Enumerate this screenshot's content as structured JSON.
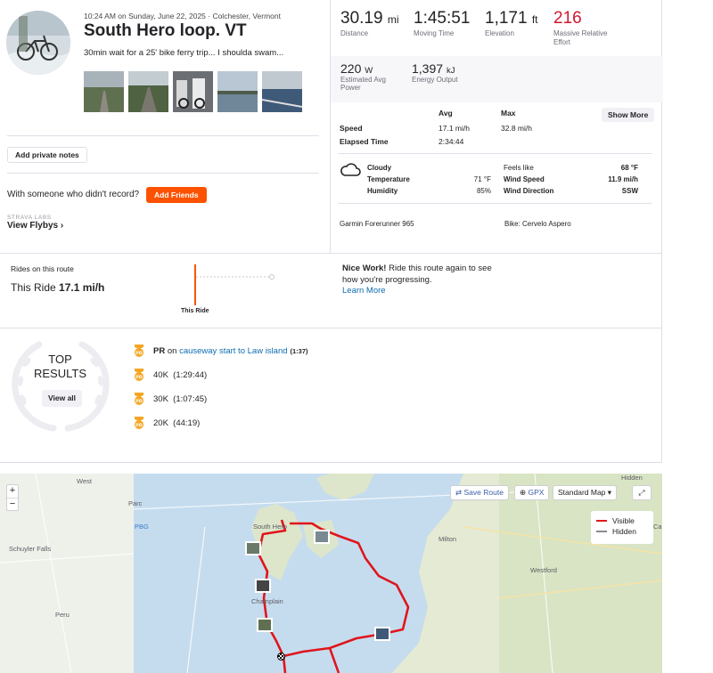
{
  "activity": {
    "datetime_location": "10:24 AM on Sunday, June 22, 2025 · Colchester, Vermont",
    "title": "South Hero loop. VT",
    "description": "30min wait for a 25' bike ferry trip... I shoulda swam..."
  },
  "actions": {
    "private_notes": "Add private notes",
    "with_someone": "With someone who didn't record?",
    "add_friends": "Add Friends",
    "labs": "STRAVA LABS",
    "view_flybys": "View Flybys ›"
  },
  "stats": {
    "distance_value": "30.19",
    "distance_unit": "mi",
    "distance_label": "Distance",
    "moving_time_value": "1:45:51",
    "moving_time_label": "Moving Time",
    "elevation_value": "1,171",
    "elevation_unit": "ft",
    "elevation_label": "Elevation",
    "effort_value": "216",
    "effort_label_1": "Massive Relative",
    "effort_label_2": "Effort",
    "power_value": "220",
    "power_unit": "W",
    "power_label_1": "Estimated Avg",
    "power_label_2": "Power",
    "energy_value": "1,397",
    "energy_unit": "kJ",
    "energy_label": "Energy Output"
  },
  "table": {
    "avg_header": "Avg",
    "max_header": "Max",
    "show_more": "Show More",
    "speed_label": "Speed",
    "speed_avg": "17.1 mi/h",
    "speed_max": "32.8 mi/h",
    "elapsed_label": "Elapsed Time",
    "elapsed_avg": "2:34:44"
  },
  "weather": {
    "condition": "Cloudy",
    "temp_label": "Temperature",
    "temp_value": "71 °F",
    "humidity_label": "Humidity",
    "humidity_value": "85%",
    "feels_label": "Feels like",
    "feels_value": "68 °F",
    "wind_speed_label": "Wind Speed",
    "wind_speed_value": "11.9 mi/h",
    "wind_dir_label": "Wind Direction",
    "wind_dir_value": "SSW"
  },
  "gear": {
    "device": "Garmin Forerunner 965",
    "bike": "Bike: Cervelo Aspero"
  },
  "rides": {
    "label": "Rides on this route",
    "this_ride_prefix": "This Ride",
    "this_ride_speed": "17.1 mi/h",
    "chart_label": "This Ride",
    "nice_work_bold": "Nice Work!",
    "nice_work_text": " Ride this route again to see how you're progressing.",
    "learn_more": "Learn More"
  },
  "top_results": {
    "title_1": "TOP",
    "title_2": "RESULTS",
    "view_all": "View all",
    "items": [
      {
        "badge": "PR",
        "prefix": "PR",
        "mid": " on ",
        "segment": "causeway start to Law island",
        "time": "(1:37)"
      },
      {
        "badge": "PR",
        "text": "40K  (1:29:44)"
      },
      {
        "badge": "PR",
        "text": "30K  (1:07:45)"
      },
      {
        "badge": "PR",
        "text": "20K  (44:19)"
      }
    ]
  },
  "map": {
    "save_route": "Save Route",
    "gpx": "GPX",
    "style": "Standard Map ▾",
    "legend_visible": "Visible",
    "legend_hidden": "Hidden",
    "route_color": "#e0151c",
    "labels": {
      "west": "West",
      "parc": "Parc",
      "pbg": "PBG",
      "schuyler": "Schuyler Falls",
      "peru": "Peru",
      "south_hero": "South Hero",
      "champlain": "Champlain",
      "milton": "Milton",
      "westford": "Westford",
      "hidden_top": "Hidden",
      "ca": "Ca"
    }
  }
}
